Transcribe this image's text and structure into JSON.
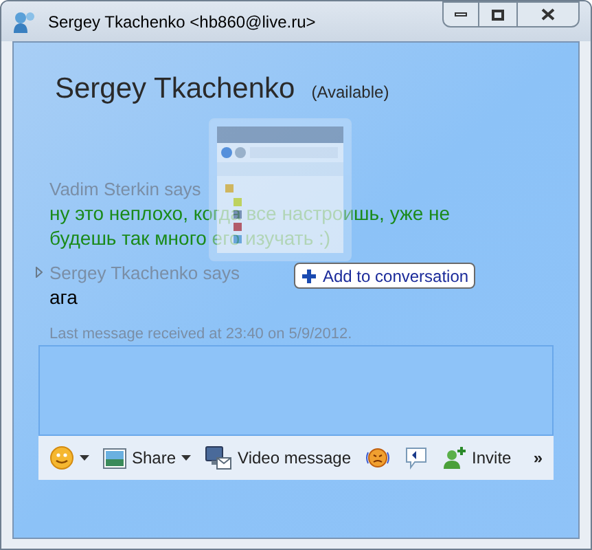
{
  "window": {
    "title": "Sergey Tkachenko <hb860@live.ru>"
  },
  "contact": {
    "name": "Sergey Tkachenko",
    "status": "(Available)"
  },
  "messages": [
    {
      "sender": "Vadim Sterkin says",
      "text": "ну это неплохо, когда все настроишь, уже не будешь так много его изучать :)",
      "color": "#1a8a1a",
      "collapsed": false
    },
    {
      "sender": "Sergey Tkachenko says",
      "text": "ага",
      "color": "#000000",
      "collapsed": true
    }
  ],
  "last_message": "Last message received at 23:40 on 5/9/2012.",
  "drag_tooltip": {
    "label": "Add to conversation"
  },
  "toolbar": [
    {
      "kind": "emoticon",
      "dropdown": true
    },
    {
      "kind": "share",
      "label": "Share",
      "dropdown": true
    },
    {
      "kind": "video",
      "label": "Video message",
      "dropdown": false
    },
    {
      "kind": "nudge",
      "dropdown": false
    },
    {
      "kind": "voice",
      "dropdown": false
    },
    {
      "kind": "invite",
      "label": "Invite",
      "dropdown": false
    }
  ],
  "overflow": "»"
}
